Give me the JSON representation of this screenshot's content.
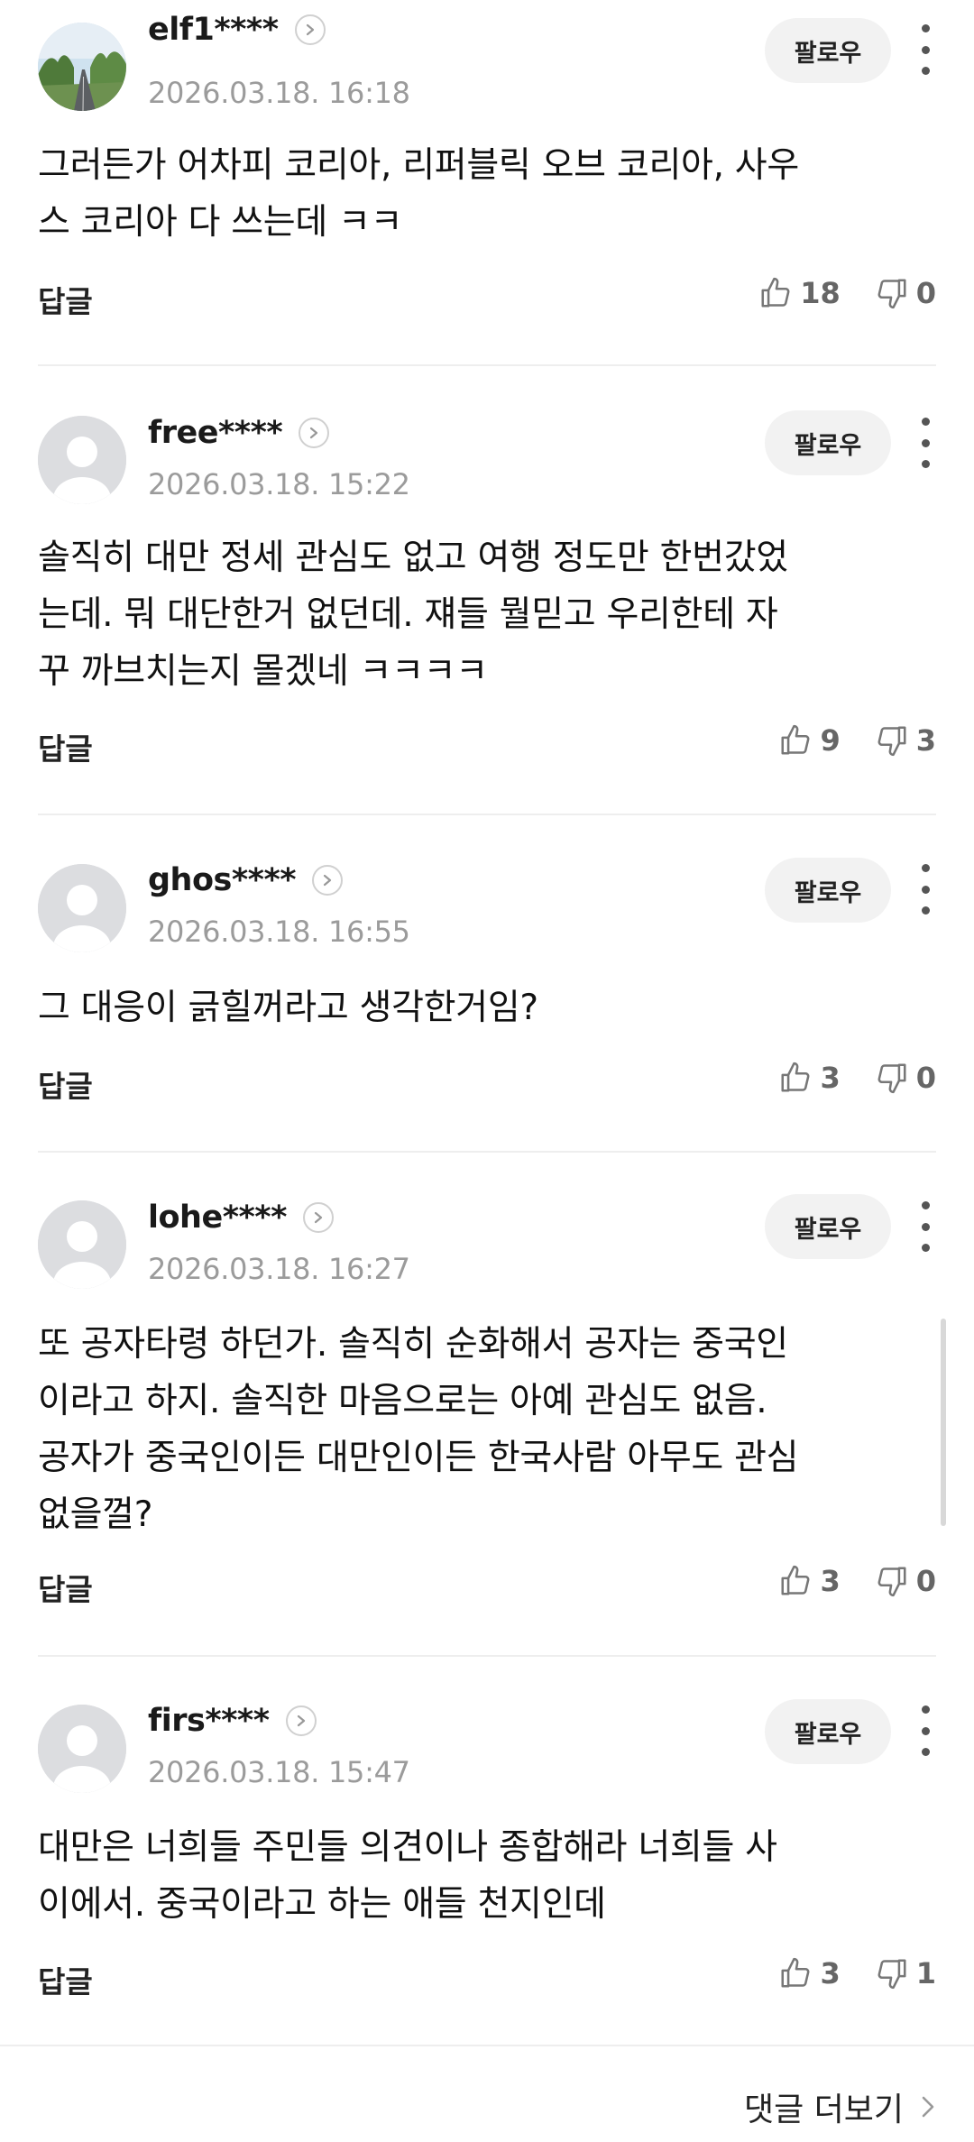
{
  "comments": [
    {
      "username": "elf1****",
      "timestamp": "2026.03.18. 16:18",
      "follow_label": "팔로우",
      "avatar": "landscape-photo",
      "text": "그러든가 어차피 코리아, 리퍼블릭 오브 코리아, 사우\n스 코리아 다 쓰는데 ㅋㅋ",
      "reply_label": "답글",
      "likes": "18",
      "dislikes": "0"
    },
    {
      "username": "free****",
      "timestamp": "2026.03.18. 15:22",
      "follow_label": "팔로우",
      "avatar": "default-person",
      "text": "솔직히 대만 정세 관심도 없고 여행 정도만 한번갔었\n는데. 뭐 대단한거 없던데. 쟤들 뭘믿고 우리한테 자\n꾸 까브치는지 몰겠네 ㅋㅋㅋㅋ",
      "reply_label": "답글",
      "likes": "9",
      "dislikes": "3"
    },
    {
      "username": "ghos****",
      "timestamp": "2026.03.18. 16:55",
      "follow_label": "팔로우",
      "avatar": "default-person",
      "text": "그 대응이 긁힐꺼라고 생각한거임?",
      "reply_label": "답글",
      "likes": "3",
      "dislikes": "0"
    },
    {
      "username": "lohe****",
      "timestamp": "2026.03.18. 16:27",
      "follow_label": "팔로우",
      "avatar": "default-person",
      "text": "또 공자타령 하던가. 솔직히 순화해서 공자는 중국인\n이라고 하지. 솔직한 마음으로는 아예 관심도 없음.\n공자가 중국인이든 대만인이든 한국사람 아무도 관심\n없을껄?",
      "reply_label": "답글",
      "likes": "3",
      "dislikes": "0"
    },
    {
      "username": "firs****",
      "timestamp": "2026.03.18. 15:47",
      "follow_label": "팔로우",
      "avatar": "default-person",
      "text": "대만은 너희들 주민들 의견이나 종합해라 너희들 사\n이에서. 중국이라고 하는 애들 천지인데",
      "reply_label": "답글",
      "likes": "3",
      "dislikes": "1"
    }
  ],
  "footer": {
    "more_comments_label": "댓글 더보기"
  },
  "colors": {
    "text": "#111111",
    "muted": "#9b9b9b",
    "icon": "#666666",
    "follow_bg": "#f2f2f2",
    "divider": "#eeeeee"
  }
}
